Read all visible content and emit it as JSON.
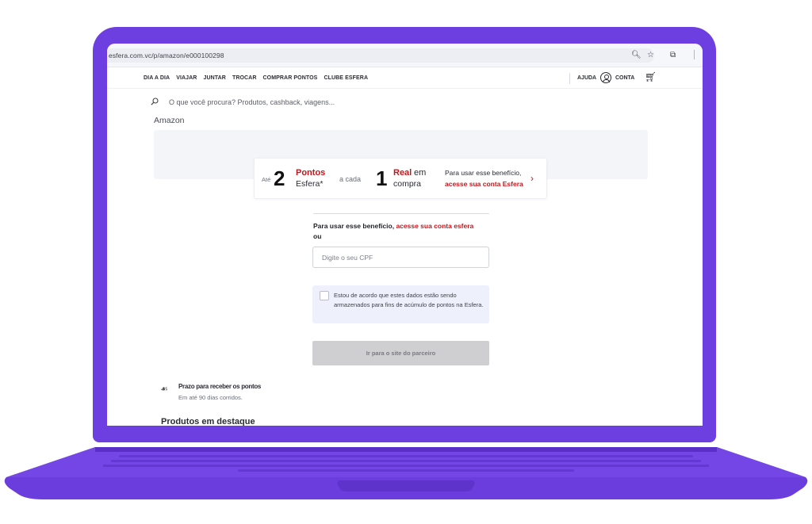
{
  "colors": {
    "laptop": "#6d3ee0",
    "accent_red": "#c4161c",
    "banner_bg": "#f3f5f9",
    "consent_bg": "#eef1fb"
  },
  "browser": {
    "url": "esfera.com.vc/p/amazon/e000100298",
    "icons": [
      "zoom-icon",
      "star-icon",
      "extension-icon",
      "download-icon"
    ]
  },
  "nav": {
    "items": [
      "DIA A DIA",
      "VIAJAR",
      "JUNTAR",
      "TROCAR",
      "COMPRAR PONTOS",
      "CLUBE ESFERA"
    ],
    "help": "AJUDA",
    "account": "CONTA"
  },
  "search": {
    "placeholder": "O que você procura? Produtos, cashback, viagens..."
  },
  "page": {
    "title": "Amazon"
  },
  "promo": {
    "ate": "Até",
    "points_number": "2",
    "points_label": "Pontos",
    "points_brand": "Esfera*",
    "per": "a cada",
    "real_number": "1",
    "real_label": "Real",
    "real_em": "em",
    "real_compra": "compra",
    "note_line1": "Para usar esse benefício,",
    "note_link": "acesse sua conta Esfera"
  },
  "form": {
    "benefit_text": "Para usar esse benefício,",
    "benefit_link": "acesse sua conta esfera",
    "or": "ou",
    "cpf_placeholder": "Digite o seu CPF",
    "consent": "Estou de acordo que estes dados estão sendo armazenados para fins de acúmulo de pontos na Esfera.",
    "submit": "Ir para o site do parceiro"
  },
  "prazo": {
    "title": "Prazo para receber os pontos",
    "subtitle": "Em até 90 dias corridos."
  },
  "produtos": {
    "title": "Produtos em destaque"
  }
}
